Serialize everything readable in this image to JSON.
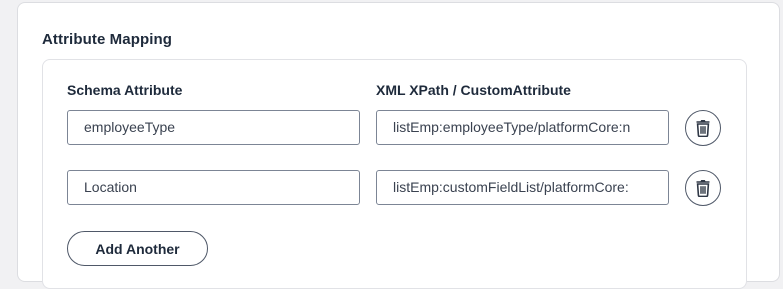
{
  "section": {
    "title": "Attribute Mapping"
  },
  "columns": {
    "schema_header": "Schema Attribute",
    "xpath_header": "XML XPath / CustomAttribute"
  },
  "rows": [
    {
      "schema_value": "employeeType",
      "xpath_value": "listEmp:employeeType/platformCore:n",
      "delete_icon": "trash-icon"
    },
    {
      "schema_value": "Location",
      "xpath_value": "listEmp:customFieldList/platformCore:",
      "delete_icon": "trash-icon"
    }
  ],
  "actions": {
    "add_another_label": "Add Another"
  },
  "colors": {
    "text_dark": "#1e2a3b",
    "border": "#7c8595",
    "icon": "#2f3745"
  }
}
